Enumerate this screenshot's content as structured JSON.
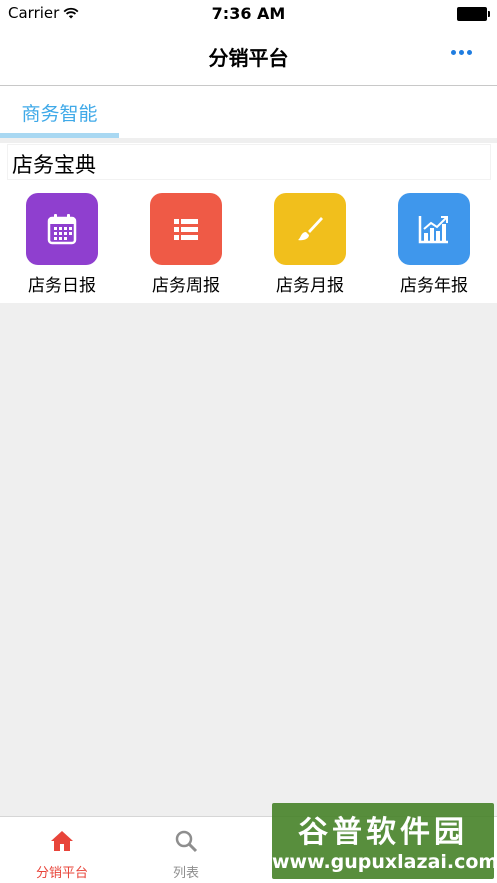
{
  "status_bar": {
    "carrier": "Carrier",
    "time": "7:36 AM"
  },
  "nav": {
    "title": "分销平台",
    "more_icon": "more-dots-icon"
  },
  "tabs": [
    {
      "label": "商务智能",
      "active": true
    }
  ],
  "section": {
    "title": "店务宝典",
    "items": [
      {
        "label": "店务日报",
        "icon": "calendar-icon",
        "color": "#8f3fcf"
      },
      {
        "label": "店务周报",
        "icon": "list-icon",
        "color": "#ef5a46"
      },
      {
        "label": "店务月报",
        "icon": "brush-icon",
        "color": "#f1bf1c"
      },
      {
        "label": "店务年报",
        "icon": "chart-icon",
        "color": "#3f97ec"
      }
    ]
  },
  "tab_bar": [
    {
      "label": "分销平台",
      "icon": "home-icon",
      "active": true
    },
    {
      "label": "列表",
      "icon": "search-icon",
      "active": false
    }
  ],
  "watermark": {
    "text": "谷普软件园",
    "url": "www.gupuxlazai.com"
  },
  "colors": {
    "accent": "#3fa9e8",
    "tab_active": "#e8443a",
    "background": "#efefef"
  }
}
